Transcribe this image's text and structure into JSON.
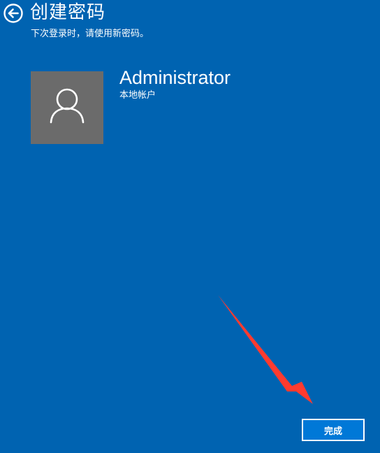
{
  "header": {
    "back_icon": "back-arrow-circle-icon",
    "title": "创建密码",
    "subtitle": "下次登录时，请使用新密码。"
  },
  "account": {
    "avatar_icon": "user-silhouette-icon",
    "username": "Administrator",
    "account_type": "本地帐户"
  },
  "annotation": {
    "icon": "red-arrow-icon",
    "color": "#ff3b2f"
  },
  "footer": {
    "finish_label": "完成"
  },
  "colors": {
    "background": "#0063b1",
    "avatar_bg": "#6b6b6b",
    "button_bg": "#0078d7",
    "text": "#ffffff"
  }
}
